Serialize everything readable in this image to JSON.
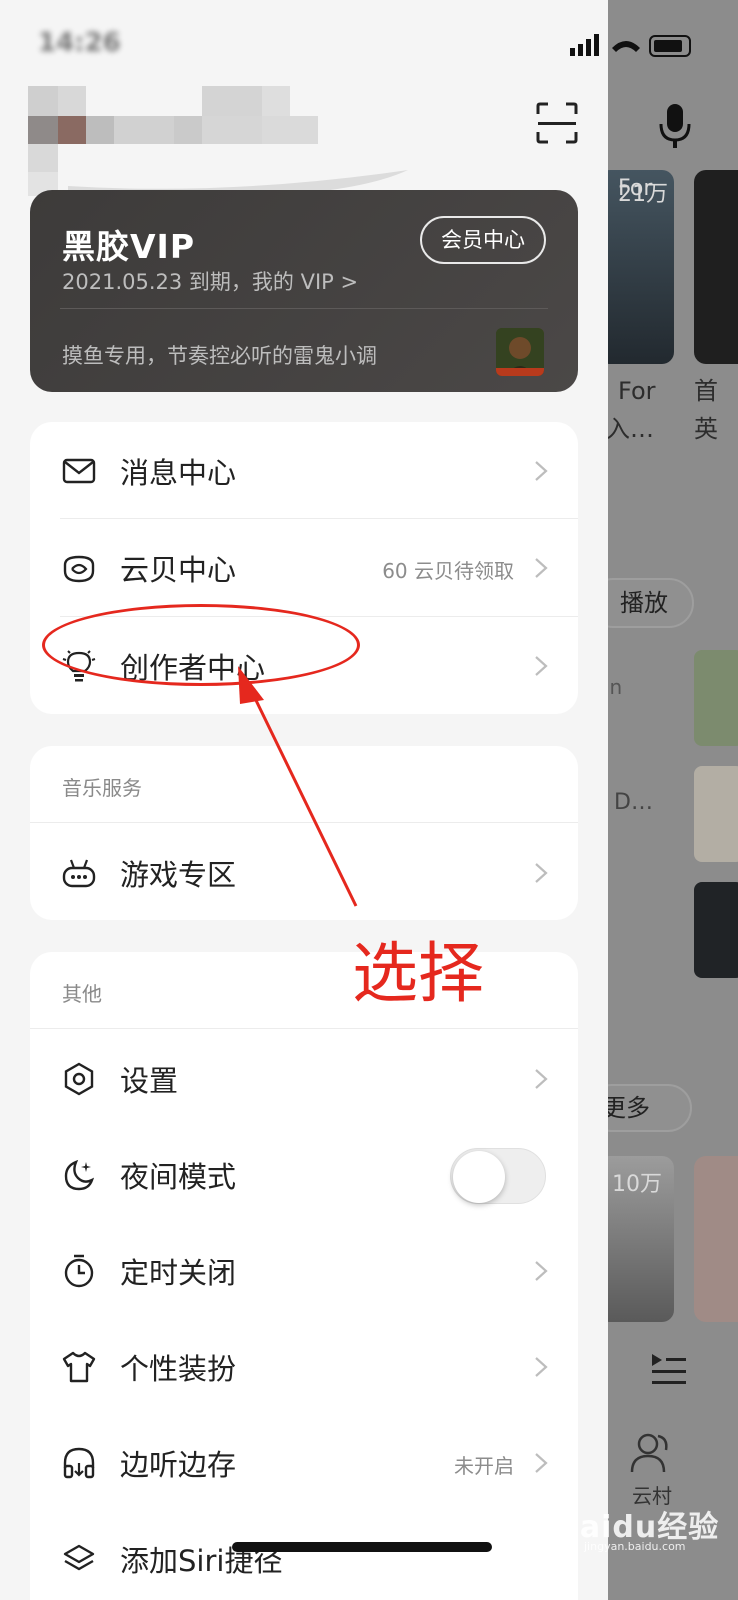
{
  "status_bar": {
    "time": "14:26"
  },
  "vip": {
    "logo": "黑胶VIP",
    "center_button": "会员中心",
    "expire_text": "2021.05.23 到期，我的 VIP >",
    "promo_text": "摸鱼专用，节奏控必听的雷鬼小调"
  },
  "section1": {
    "items": [
      {
        "label": "消息中心",
        "hint": "",
        "icon": "mail-icon"
      },
      {
        "label": "云贝中心",
        "hint": "60 云贝待领取",
        "icon": "cloud-coin-icon"
      },
      {
        "label": "创作者中心",
        "hint": "",
        "icon": "lightbulb-icon"
      }
    ]
  },
  "section2": {
    "title": "音乐服务",
    "items": [
      {
        "label": "游戏专区",
        "icon": "gamepad-icon"
      }
    ]
  },
  "section3": {
    "title": "其他",
    "items": [
      {
        "label": "设置",
        "hint": "",
        "icon": "settings-icon"
      },
      {
        "label": "夜间模式",
        "hint": "",
        "icon": "moon-icon",
        "toggle_on": false
      },
      {
        "label": "定时关闭",
        "hint": "",
        "icon": "timer-icon"
      },
      {
        "label": "个性装扮",
        "hint": "",
        "icon": "tshirt-icon"
      },
      {
        "label": "边听边存",
        "hint": "未开启",
        "icon": "headphones-icon"
      },
      {
        "label": "添加Siri捷径",
        "hint": "",
        "icon": "layers-icon"
      }
    ]
  },
  "annotation": {
    "text": "选择"
  },
  "background": {
    "badge": "21万",
    "texts": [
      "For",
      "入…",
      "首",
      "英",
      "播放",
      "in",
      "D…",
      "更多",
      "10万",
      "云村"
    ]
  },
  "watermark": {
    "brand": "Baidu经验",
    "url": "jingyan.baidu.com"
  },
  "colors": {
    "annotation": "#e5281e",
    "vip_card": "#3d3b3a"
  }
}
